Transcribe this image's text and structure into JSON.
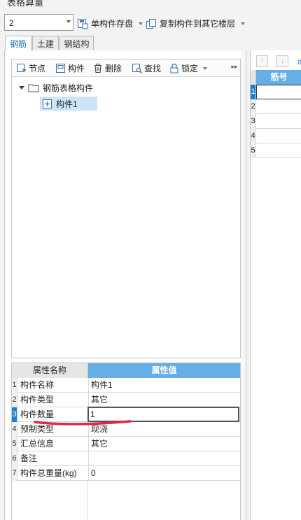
{
  "window": {
    "title": "表格算量"
  },
  "toolbar": {
    "floor_value": "2",
    "save_label": "单构件存盘",
    "copy_label": "复制构件到其它楼层"
  },
  "tabs": [
    {
      "label": "钢筋",
      "active": true
    },
    {
      "label": "土建",
      "active": false
    },
    {
      "label": "钢结构",
      "active": false
    }
  ],
  "tree_toolbar": {
    "node": "节点",
    "component": "构件",
    "delete": "删除",
    "find": "查找",
    "lock": "锁定"
  },
  "tree": {
    "root": "钢筋表格构件",
    "children": [
      "构件1"
    ]
  },
  "properties": {
    "header_name": "属性名称",
    "header_value": "属性值",
    "rows": [
      {
        "idx": "1",
        "name": "构件名称",
        "value": "构件1"
      },
      {
        "idx": "2",
        "name": "构件类型",
        "value": "其它"
      },
      {
        "idx": "3",
        "name": "构件数量",
        "value": "1"
      },
      {
        "idx": "4",
        "name": "预制类型",
        "value": "现浇"
      },
      {
        "idx": "5",
        "name": "汇总信息",
        "value": "其它"
      },
      {
        "idx": "6",
        "name": "备注",
        "value": ""
      },
      {
        "idx": "7",
        "name": "构件总重量(kg)",
        "value": "0"
      }
    ],
    "selected_row": 3
  },
  "right_grid": {
    "partial_toolbar_text": "a",
    "header": "筋号",
    "rows": [
      "1",
      "2",
      "3",
      "4",
      "5"
    ]
  },
  "colors": {
    "accent": "#66aee6",
    "selection": "#1e7fd0",
    "annotation": "#e3264a"
  },
  "icons": [
    "folder-icon",
    "component-icon",
    "lock-icon",
    "trash-icon",
    "search-icon",
    "copy-icon",
    "save-icon",
    "add-node-icon"
  ]
}
